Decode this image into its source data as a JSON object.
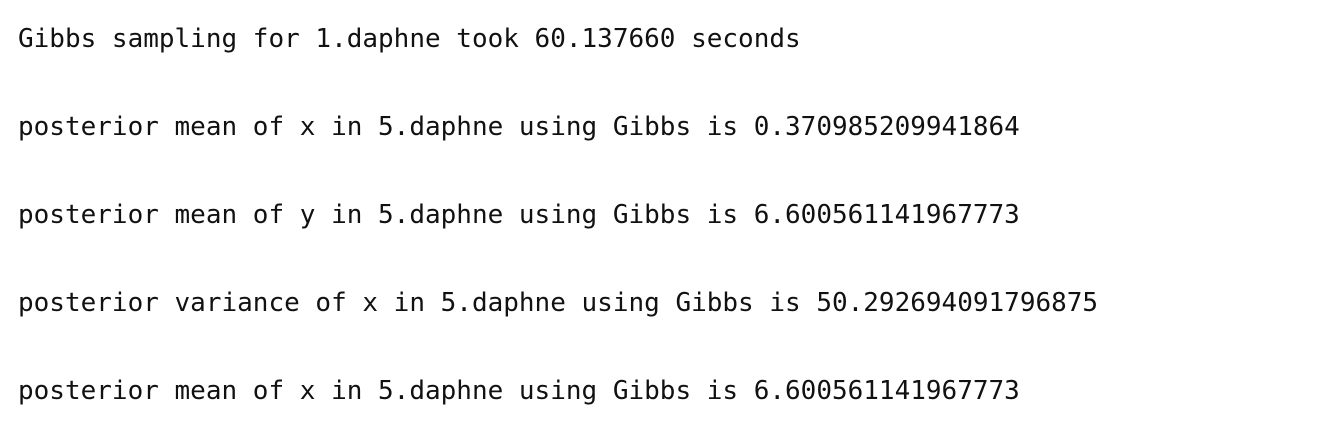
{
  "console": {
    "lines": [
      "Gibbs sampling for 1.daphne took 60.137660 seconds",
      "posterior mean of x in 5.daphne using Gibbs is 0.370985209941864",
      "posterior mean of y in 5.daphne using Gibbs is 6.600561141967773",
      "posterior variance of x in 5.daphne using Gibbs is 50.292694091796875",
      "posterior mean of x in 5.daphne using Gibbs is 6.600561141967773"
    ]
  }
}
